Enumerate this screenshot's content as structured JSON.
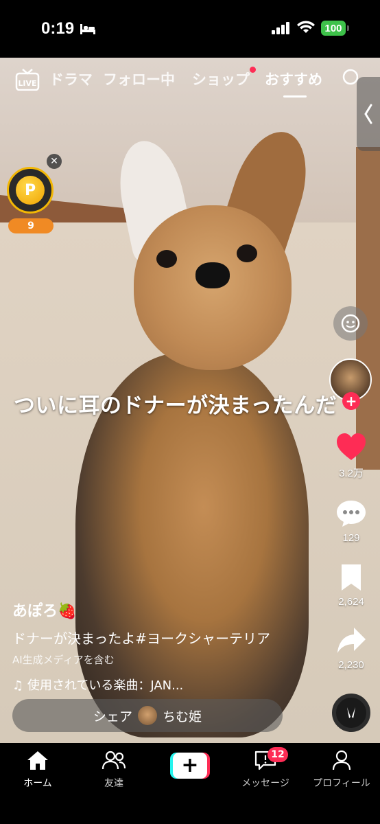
{
  "status_bar": {
    "time": "0:19",
    "battery": "100",
    "icons": [
      "bed-icon",
      "signal-icon",
      "wifi-icon"
    ]
  },
  "top_nav": {
    "live_label": "LIVE",
    "tabs": [
      {
        "label": "ドラマ"
      },
      {
        "label": "フォロー中"
      },
      {
        "label": "ショップ"
      },
      {
        "label": "おすすめ"
      }
    ],
    "active_tab": "おすすめ"
  },
  "coin_widget": {
    "coin_symbol": "P",
    "count": "9",
    "close_symbol": "✕"
  },
  "video": {
    "overlay_text": "ついに耳のドナーが決まったんだ"
  },
  "side_rail": {
    "like_count": "3.2万",
    "comment_count": "129",
    "bookmark_count": "2,624",
    "share_count": "2,230",
    "follow_symbol": "+"
  },
  "caption": {
    "username": "あぽろ🍓",
    "text": "ドナーが決まったよ#ヨークシャーテリア",
    "ai_label": "AI生成メディアを含む",
    "music_prefix": "♫",
    "music": "使用されている楽曲：JAN..."
  },
  "share_bar": {
    "label": "シェア",
    "user": "ちむ姫"
  },
  "bottom_nav": {
    "items": [
      {
        "label": "ホーム",
        "icon": "home-icon"
      },
      {
        "label": "友達",
        "icon": "friends-icon"
      },
      {
        "label": "+",
        "icon": "create-icon"
      },
      {
        "label": "メッセージ",
        "icon": "message-icon",
        "badge": "12"
      },
      {
        "label": "プロフィール",
        "icon": "profile-icon"
      }
    ]
  },
  "colors": {
    "accent": "#fe2c55",
    "cyan": "#25f4ee",
    "battery": "#3ec24a",
    "coin": "#f2b705"
  }
}
